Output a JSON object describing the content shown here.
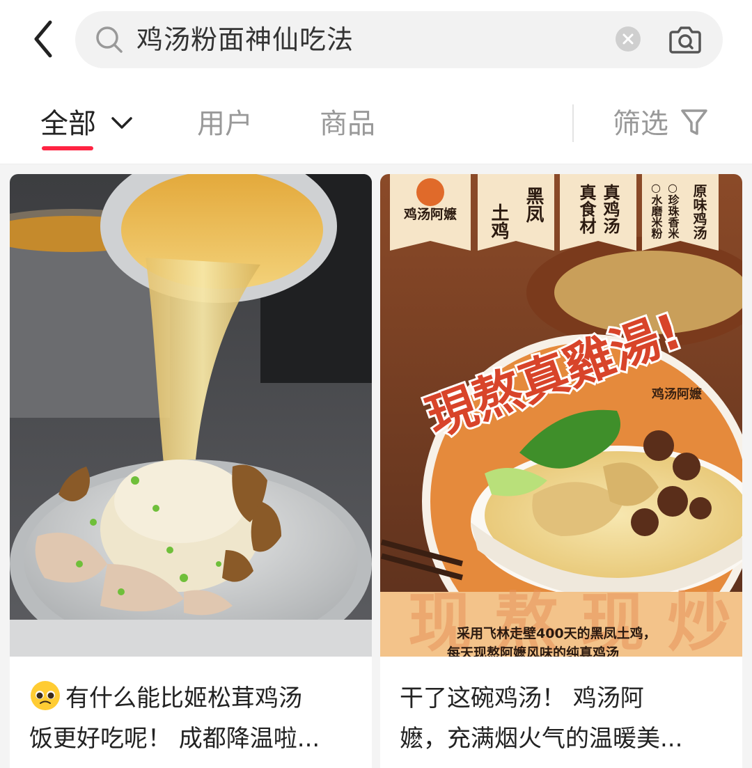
{
  "search": {
    "query": "鸡汤粉面神仙吃法",
    "back_icon": "chevron-left-icon",
    "search_icon": "search-icon",
    "clear_icon": "close-circle-icon",
    "camera_icon": "camera-icon"
  },
  "tabs": {
    "all": "全部",
    "users": "用户",
    "products": "商品",
    "filter": "筛选",
    "active": "all",
    "accent": "#ff2442"
  },
  "cards": [
    {
      "title_line1": "有什么能比姬松茸鸡汤",
      "title_line2": "饭更好吃呢！ 成都降温啦...",
      "emoji": "pleading-face-icon"
    },
    {
      "title_line1": "干了这碗鸡汤！ 鸡汤阿",
      "title_line2": "嬷，充满烟火气的温暖美...",
      "poster": {
        "brand": "鸡汤阿嬷",
        "banners": [
          "土鸡",
          "黑凤",
          "真鸡汤",
          "真食材",
          "原味鸡汤",
          "○珍珠香米",
          "○水磨米粉"
        ],
        "headline": "現熬真雞湯!",
        "bowl_brand": "鸡汤阿嬷",
        "caption_line1": "采用飞林走壁400天的黑凤土鸡，",
        "caption_line2": "每天现熬阿嬷风味的纯真鸡汤"
      }
    }
  ]
}
